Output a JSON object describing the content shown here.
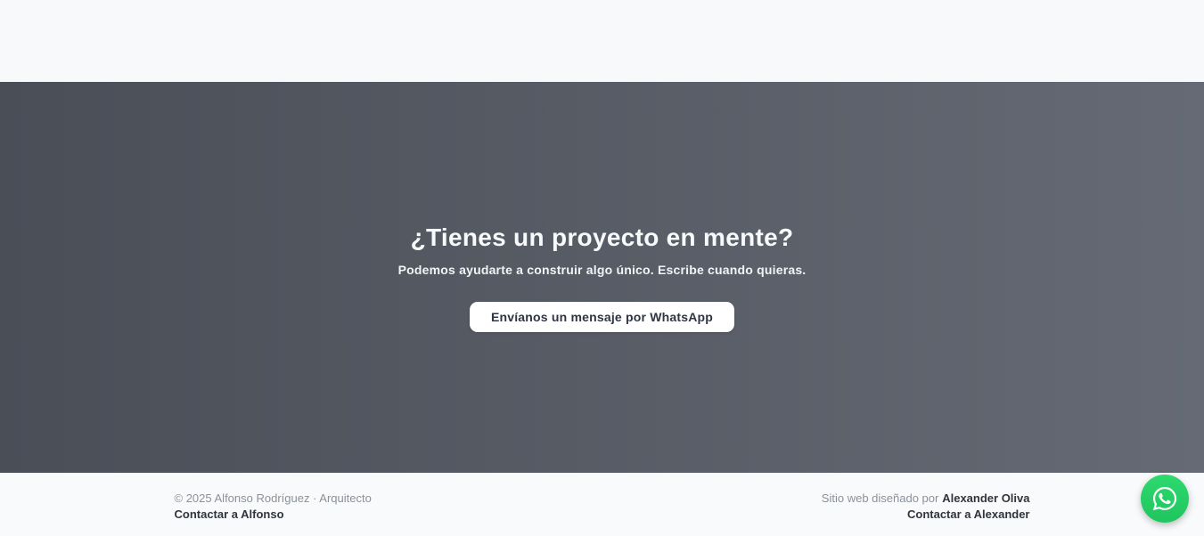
{
  "cta": {
    "title": "¿Tienes un proyecto en mente?",
    "subtitle": "Podemos ayudarte a construir algo único. Escribe cuando quieras.",
    "whatsapp_button_label": "Envíanos un mensaje por WhatsApp"
  },
  "footer": {
    "copyright": "© 2025 Alfonso Rodríguez · Arquitecto",
    "contact_alfonso_label": "Contactar a Alfonso",
    "designed_by_prefix": "Sitio web diseñado por",
    "designer_name": "Alexander Oliva",
    "contact_alexander_label": "Contactar a Alexander"
  },
  "icons": {
    "floating_action": "whatsapp-icon"
  },
  "colors": {
    "cta_gradient_left": "#4a4e57",
    "cta_gradient_right": "#656a74",
    "whatsapp_green": "#25d366",
    "top_strip_background": "#f8f9fa",
    "footer_background": "#f9fafb",
    "button_background": "#ffffff",
    "button_text": "#2f3542",
    "muted_text": "#8a919c",
    "dark_text": "#30353d"
  }
}
